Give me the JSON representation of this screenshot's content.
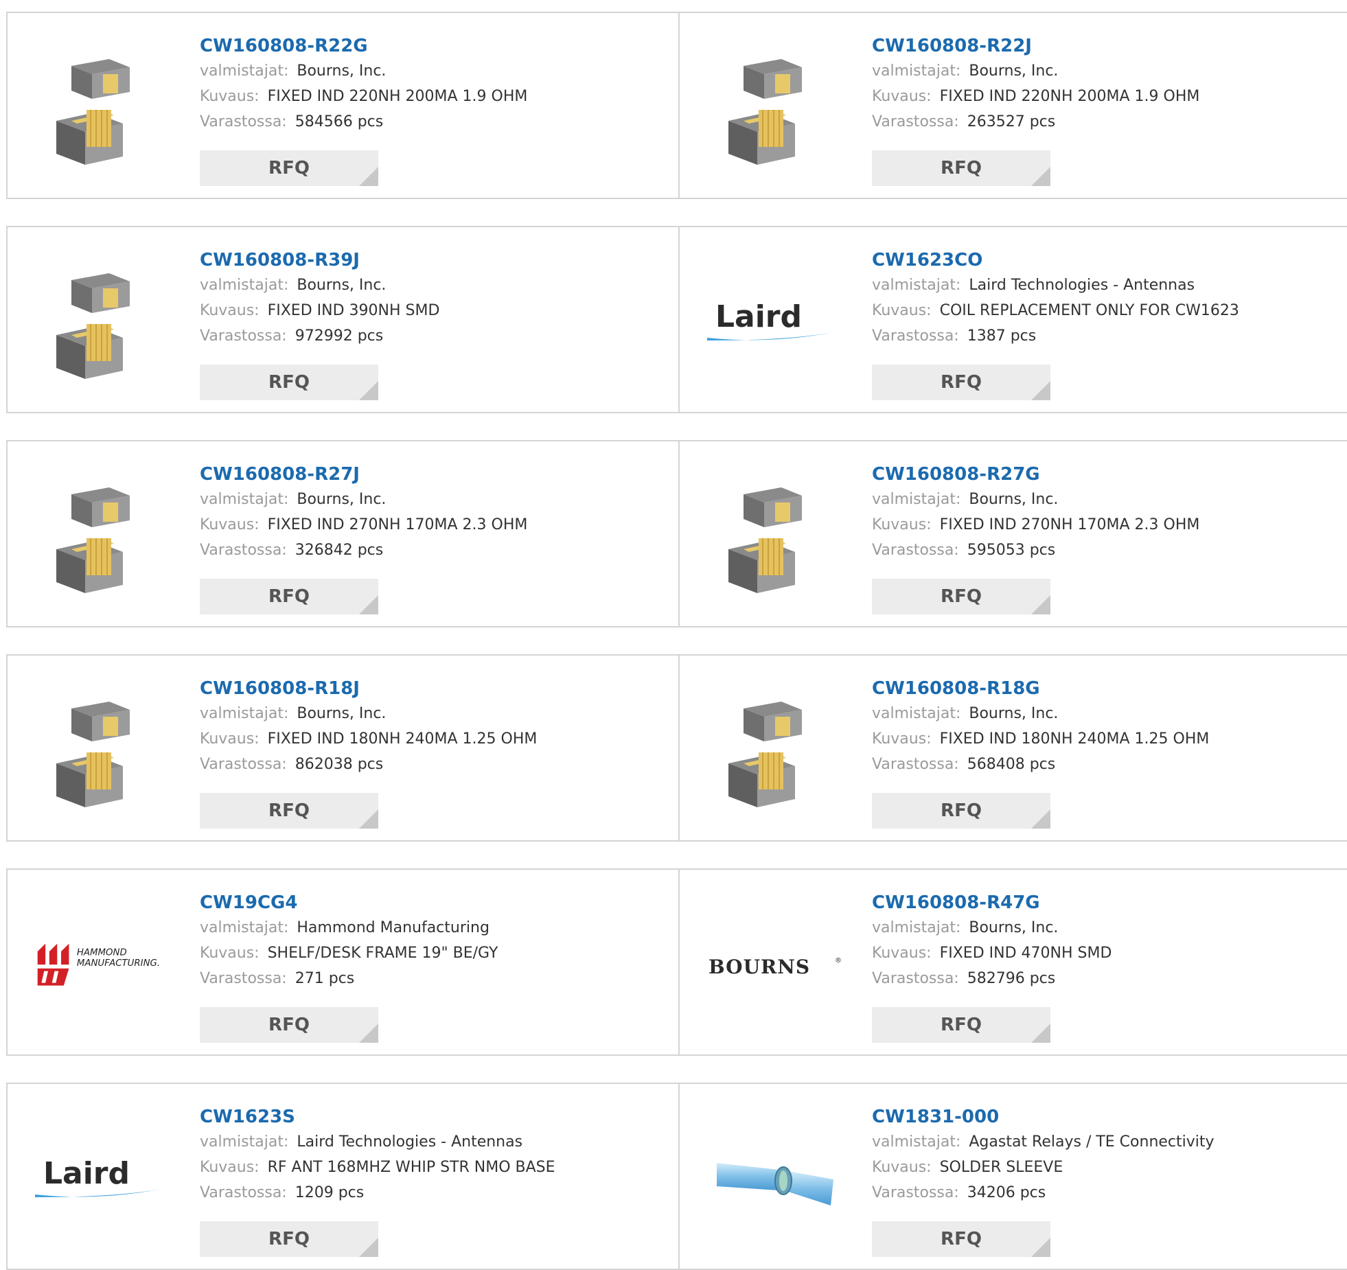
{
  "labels": {
    "manufacturer": "valmistajat:",
    "description": "Kuvaus:",
    "stock": "Varastossa:",
    "rfq": "RFQ"
  },
  "products": [
    {
      "part": "CW160808-R22G",
      "manufacturer": "Bourns, Inc.",
      "description": "FIXED IND 220NH 200MA 1.9 OHM",
      "stock": "584566 pcs",
      "image": "inductor-image"
    },
    {
      "part": "CW160808-R22J",
      "manufacturer": "Bourns, Inc.",
      "description": "FIXED IND 220NH 200MA 1.9 OHM",
      "stock": "263527 pcs",
      "image": "inductor-image"
    },
    {
      "part": "CW160808-R39J",
      "manufacturer": "Bourns, Inc.",
      "description": "FIXED IND 390NH SMD",
      "stock": "972992 pcs",
      "image": "inductor-image"
    },
    {
      "part": "CW1623CO",
      "manufacturer": "Laird Technologies - Antennas",
      "description": "COIL REPLACEMENT ONLY FOR CW1623",
      "stock": "1387 pcs",
      "image": "laird-logo",
      "logo_text": "Laird"
    },
    {
      "part": "CW160808-R27J",
      "manufacturer": "Bourns, Inc.",
      "description": "FIXED IND 270NH 170MA 2.3 OHM",
      "stock": "326842 pcs",
      "image": "inductor-image"
    },
    {
      "part": "CW160808-R27G",
      "manufacturer": "Bourns, Inc.",
      "description": "FIXED IND 270NH 170MA 2.3 OHM",
      "stock": "595053 pcs",
      "image": "inductor-image"
    },
    {
      "part": "CW160808-R18J",
      "manufacturer": "Bourns, Inc.",
      "description": "FIXED IND 180NH 240MA 1.25 OHM",
      "stock": "862038 pcs",
      "image": "inductor-image"
    },
    {
      "part": "CW160808-R18G",
      "manufacturer": "Bourns, Inc.",
      "description": "FIXED IND 180NH 240MA 1.25 OHM",
      "stock": "568408 pcs",
      "image": "inductor-image"
    },
    {
      "part": "CW19CG4",
      "manufacturer": "Hammond Manufacturing",
      "description": "SHELF/DESK FRAME 19\" BE/GY",
      "stock": "271 pcs",
      "image": "hammond-logo",
      "logo_text": "HAMMOND MANUFACTURING."
    },
    {
      "part": "CW160808-R47G",
      "manufacturer": "Bourns, Inc.",
      "description": "FIXED IND 470NH SMD",
      "stock": "582796 pcs",
      "image": "bourns-logo",
      "logo_text": "BOURNS"
    },
    {
      "part": "CW1623S",
      "manufacturer": "Laird Technologies - Antennas",
      "description": "RF ANT 168MHZ WHIP STR NMO BASE",
      "stock": "1209 pcs",
      "image": "laird-logo",
      "logo_text": "Laird"
    },
    {
      "part": "CW1831-000",
      "manufacturer": "Agastat Relays / TE Connectivity",
      "description": "SOLDER SLEEVE",
      "stock": "34206 pcs",
      "image": "solder-sleeve-image"
    }
  ],
  "colors": {
    "part_link": "#1b6aae",
    "label": "#9a9a9a",
    "button_bg": "#ececec",
    "border": "#d4d4d4",
    "hammond_red": "#d32027",
    "laird_blue": "#3aa0dc"
  }
}
